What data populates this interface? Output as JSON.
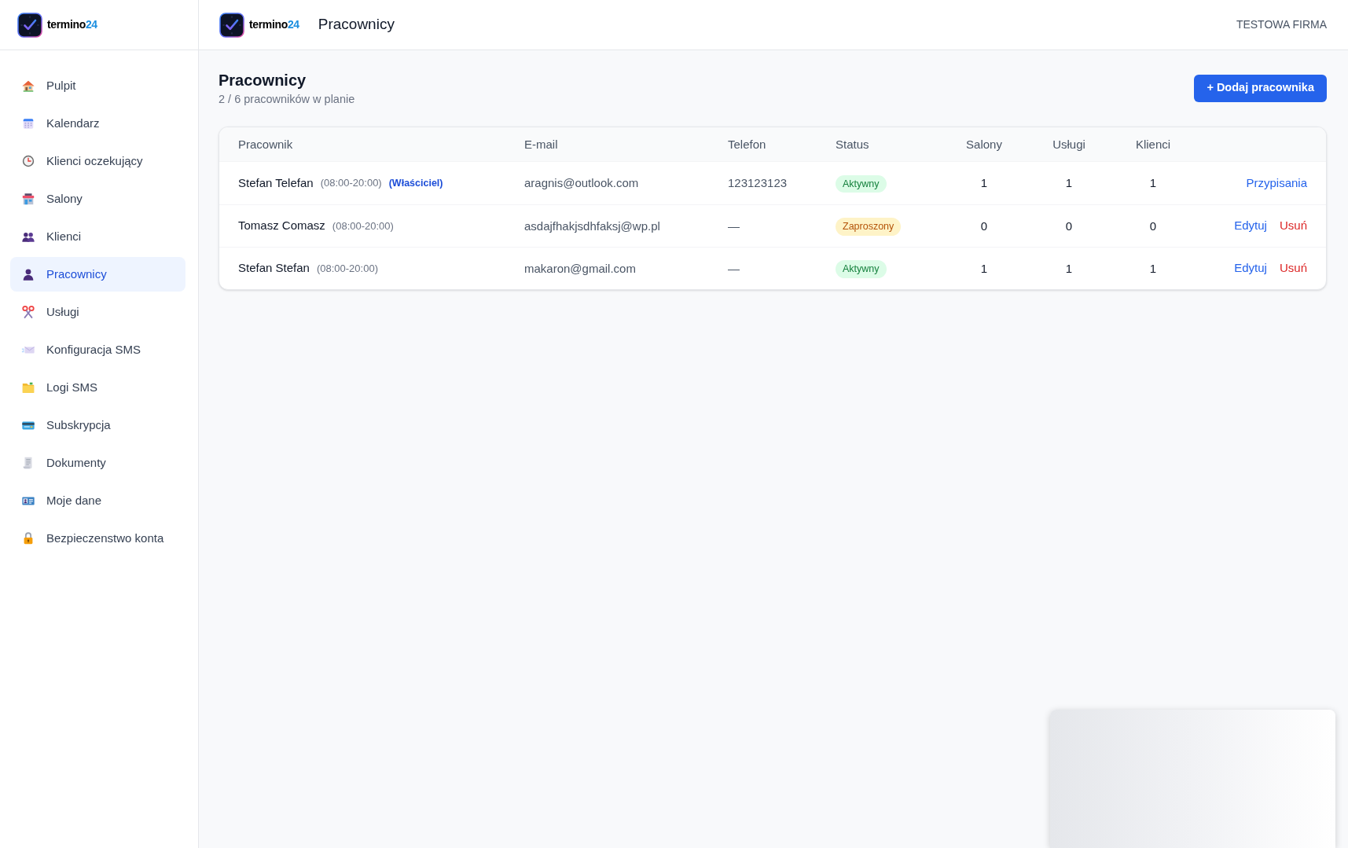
{
  "sidebar": {
    "logo": {
      "wordmark": "termino",
      "number": "24"
    },
    "items": [
      {
        "label": "Pulpit",
        "selected": false
      },
      {
        "label": "Kalendarz",
        "selected": false
      },
      {
        "label": "Klienci oczekujący",
        "selected": false
      },
      {
        "label": "Salony",
        "selected": false
      },
      {
        "label": "Klienci",
        "selected": false
      },
      {
        "label": "Pracownicy",
        "selected": true
      },
      {
        "label": "Usługi",
        "selected": false
      },
      {
        "label": "Konfiguracja SMS",
        "selected": false
      },
      {
        "label": "Logi SMS",
        "selected": false
      },
      {
        "label": "Subskrypcja",
        "selected": false
      },
      {
        "label": "Dokumenty",
        "selected": false
      },
      {
        "label": "Moje dane",
        "selected": false
      },
      {
        "label": "Bezpieczenstwo konta",
        "selected": false
      }
    ]
  },
  "header": {
    "logo": {
      "wordmark": "termino",
      "number": "24"
    },
    "title": "Pracownicy",
    "company": "TESTOWA FIRMA"
  },
  "page": {
    "title": "Pracownicy",
    "subtitle": "2 / 6 pracowników w planie",
    "add_button": "+ Dodaj pracownika"
  },
  "table": {
    "columns": [
      "Pracownik",
      "E-mail",
      "Telefon",
      "Status",
      "Salony",
      "Usługi",
      "Klienci"
    ],
    "rows": [
      {
        "name": "Stefan Telefan",
        "hours": "(08:00-20:00)",
        "role": "(Właściciel)",
        "email": "aragnis@outlook.com",
        "phone": "123123123",
        "status": {
          "label": "Aktywny",
          "kind": "active"
        },
        "salons": "1",
        "services": "1",
        "clients": "1",
        "actions": [
          {
            "label": "Przypisania",
            "kind": "primary"
          }
        ]
      },
      {
        "name": "Tomasz Comasz",
        "hours": "(08:00-20:00)",
        "email": "asdajfhakjsdhfaksj@wp.pl",
        "phone": "—",
        "status": {
          "label": "Zaproszony",
          "kind": "invited"
        },
        "salons": "0",
        "services": "0",
        "clients": "0",
        "actions": [
          {
            "label": "Edytuj",
            "kind": "primary"
          },
          {
            "label": "Usuń",
            "kind": "danger"
          }
        ]
      },
      {
        "name": "Stefan Stefan",
        "hours": "(08:00-20:00)",
        "email": "makaron@gmail.com",
        "phone": "—",
        "status": {
          "label": "Aktywny",
          "kind": "active"
        },
        "salons": "1",
        "services": "1",
        "clients": "1",
        "actions": [
          {
            "label": "Edytuj",
            "kind": "primary"
          },
          {
            "label": "Usuń",
            "kind": "danger"
          }
        ]
      }
    ]
  }
}
